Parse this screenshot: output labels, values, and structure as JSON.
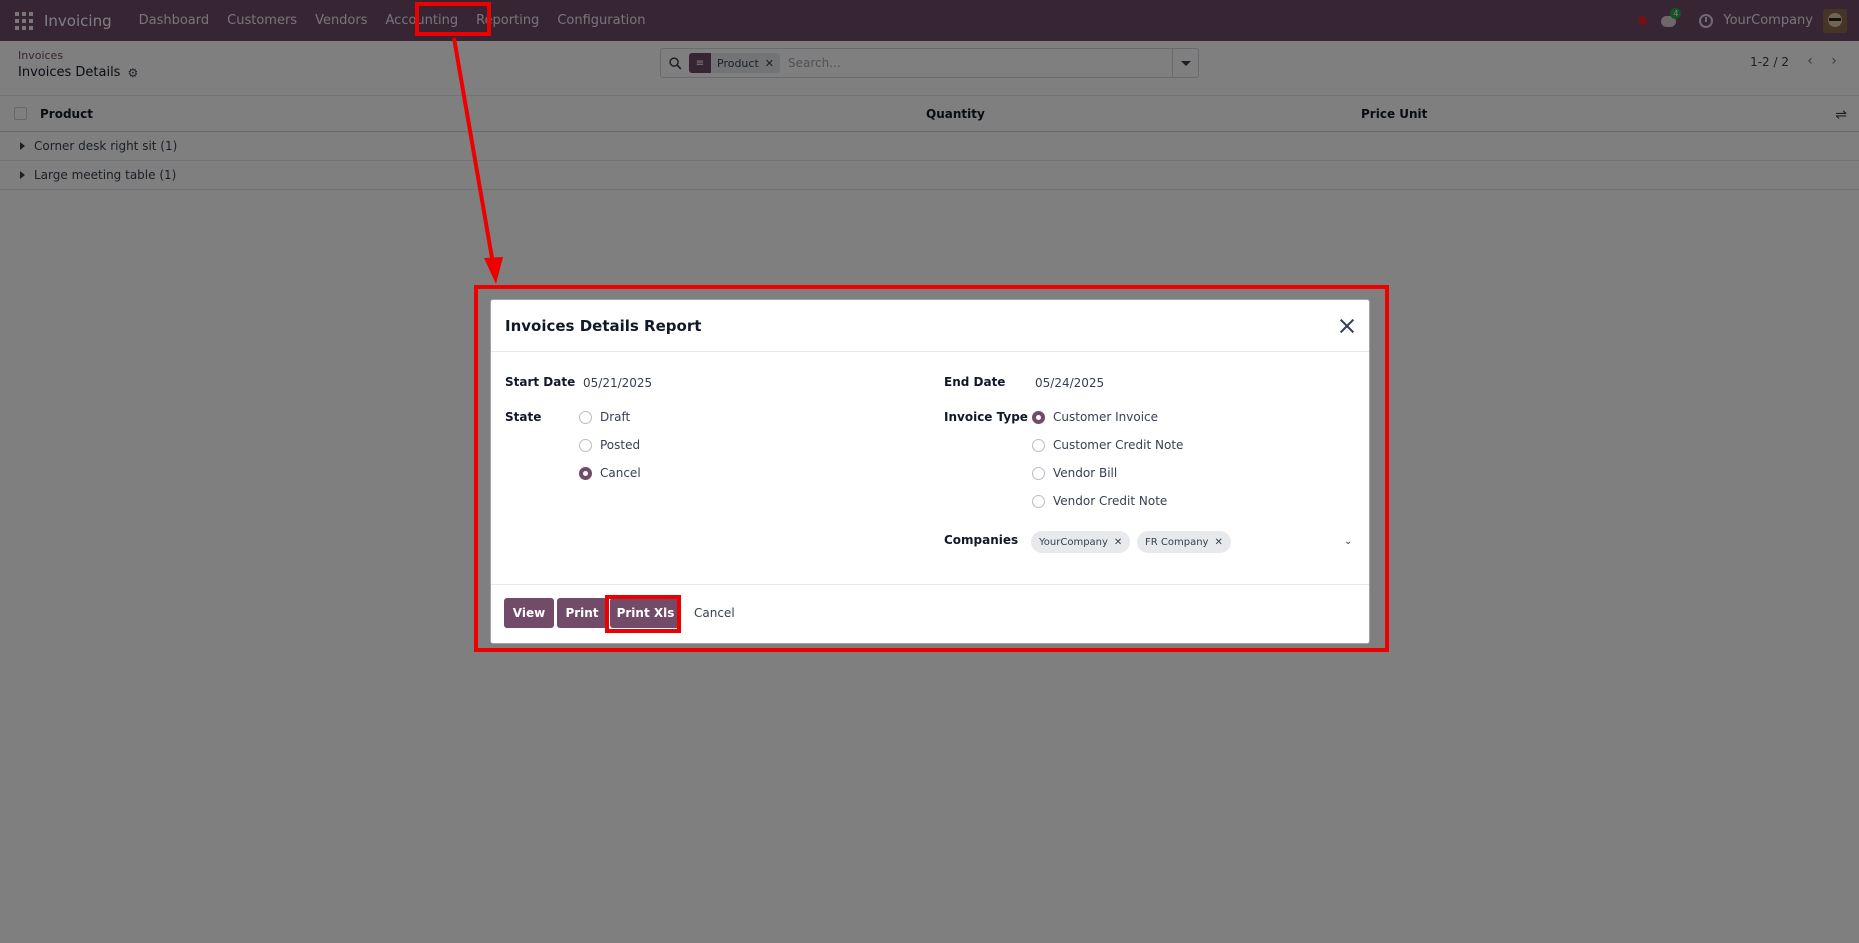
{
  "navbar": {
    "app_name": "Invoicing",
    "menu": [
      "Dashboard",
      "Customers",
      "Vendors",
      "Accounting",
      "Reporting",
      "Configuration"
    ],
    "chat_badge": "4",
    "company": "YourCompany"
  },
  "control_panel": {
    "breadcrumb_parent": "Invoices",
    "breadcrumb_current": "Invoices Details",
    "search": {
      "facet_label": "Product",
      "facet_remove": "✕",
      "placeholder": "Search..."
    },
    "pager": "1-2 / 2"
  },
  "list": {
    "columns": [
      "Product",
      "Quantity",
      "Price Unit"
    ],
    "groups": [
      "Corner desk right sit (1)",
      "Large meeting table (1)"
    ]
  },
  "dialog": {
    "title": "Invoices Details Report",
    "start_date_label": "Start Date",
    "start_date": "05/21/2025",
    "end_date_label": "End Date",
    "end_date": "05/24/2025",
    "state_label": "State",
    "state_options": [
      {
        "label": "Draft",
        "checked": false
      },
      {
        "label": "Posted",
        "checked": false
      },
      {
        "label": "Cancel",
        "checked": true
      }
    ],
    "invoice_type_label": "Invoice Type",
    "invoice_type_options": [
      {
        "label": "Customer Invoice",
        "checked": true
      },
      {
        "label": "Customer Credit Note",
        "checked": false
      },
      {
        "label": "Vendor Bill",
        "checked": false
      },
      {
        "label": "Vendor Credit Note",
        "checked": false
      }
    ],
    "companies_label": "Companies",
    "companies": [
      "YourCompany",
      "FR Company"
    ],
    "buttons": {
      "view": "View",
      "print": "Print",
      "print_xls": "Print Xls",
      "cancel": "Cancel"
    }
  },
  "colors": {
    "brand": "#714B67",
    "highlight": "#ee0000"
  }
}
